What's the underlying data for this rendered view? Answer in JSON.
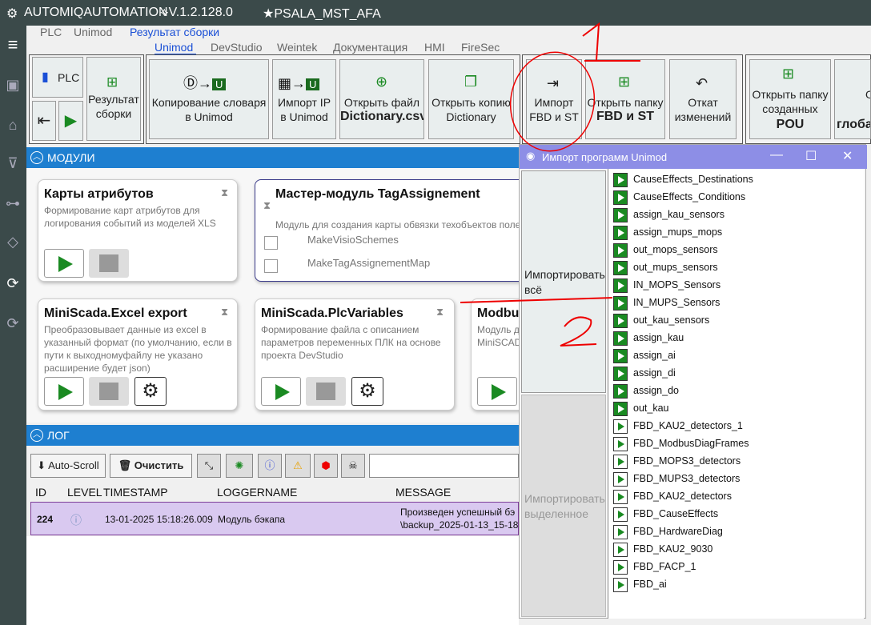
{
  "app": {
    "title": "AUTOMIQAUTOMATION",
    "version": "⟡V.1.2.128.0",
    "project": "★PSALA_MST_AFA"
  },
  "colors": {
    "titlebar": "#3b4a4a",
    "accent": "#1e7fd0",
    "dialog_title": "#8d8ee6",
    "selected_row": "#d9c9f0",
    "play": "#1a8a22"
  },
  "nav": {
    "top_tabs": [
      "PLC",
      "Unimod",
      "Результат сборки"
    ],
    "sub_tabs": [
      "Unimod",
      "DevStudio",
      "Weintek",
      "Документация",
      "HMI",
      "FireSec"
    ]
  },
  "ribbon": {
    "plc": "PLC",
    "result_build": "Результат\nсборки",
    "copy_dict": "Копирование словаря\nв Unimod",
    "import_ip": "Импорт IP\nв Unimod",
    "open_file": "Открыть файл",
    "open_file_bold": "Dictionary.csv",
    "open_copy": "Открыть копию\nDictionary",
    "import_fbd": "Импорт\nFBD и ST",
    "open_folder": "Открыть папку",
    "open_folder_bold": "FBD и ST",
    "undo": "Откат\nизменений",
    "open_created": "Открыть папку\nсозданных",
    "open_created_bold": "POU",
    "cut_o": "О",
    "cut_glob": "глоба"
  },
  "modules": {
    "header": "МОДУЛИ",
    "cards": [
      {
        "title": "Карты атрибутов",
        "desc": "Формирование карт атрибутов для логирования событий из моделей XLS"
      },
      {
        "title": "Мастер-модуль TagAssignement",
        "desc": "Модуль для создания карты обвязки техобъектов поле"
      },
      {
        "title": "MiniScada.Excel export",
        "desc": "Преобразовывает данные из excel в указанный формат (по умолчанию, если в пути к выходномуфайлу не указано расширение будет json)"
      },
      {
        "title": "MiniScada.PlcVariables",
        "desc": "Формирование файла с описанием параметров переменных ПЛК на основе проекта DevStudio"
      },
      {
        "title": "Modbu",
        "desc": "Модуль д MiniSCAD"
      }
    ],
    "checks": [
      "MakeVisioSchemes",
      "MakeTagAssignementMap"
    ]
  },
  "log": {
    "header": "ЛОГ",
    "autoscroll": "Auto-Scroll",
    "clear": "Очистить",
    "columns": [
      "ID",
      "LEVEL",
      "TIMESTAMP",
      "LOGGERNAME",
      "MESSAGE"
    ],
    "row": {
      "id": "224",
      "timestamp": "13-01-2025 15:18:26.009",
      "logger": "Модуль бэкапа",
      "message1": "Произведен успешный бэ",
      "message2": "\\backup_2025-01-13_15-18-"
    }
  },
  "dialog": {
    "title": "Импорт программ Unimod",
    "import_all": "Импортировать\nвсё",
    "import_selected": "Импортировать\nвыделенное",
    "items": [
      "CauseEffects_Destinations",
      "CauseEffects_Conditions",
      "assign_kau_sensors",
      "assign_mups_mops",
      "out_mops_sensors",
      "out_mups_sensors",
      "IN_MOPS_Sensors",
      "IN_MUPS_Sensors",
      "out_kau_sensors",
      "assign_kau",
      "assign_ai",
      "assign_di",
      "assign_do",
      "out_kau",
      "FBD_KAU2_detectors_1",
      "FBD_ModbusDiagFrames",
      "FBD_MOPS3_detectors",
      "FBD_MUPS3_detectors",
      "FBD_KAU2_detectors",
      "FBD_CauseEffects",
      "FBD_HardwareDiag",
      "FBD_KAU2_9030",
      "FBD_FACP_1",
      "FBD_ai"
    ]
  }
}
